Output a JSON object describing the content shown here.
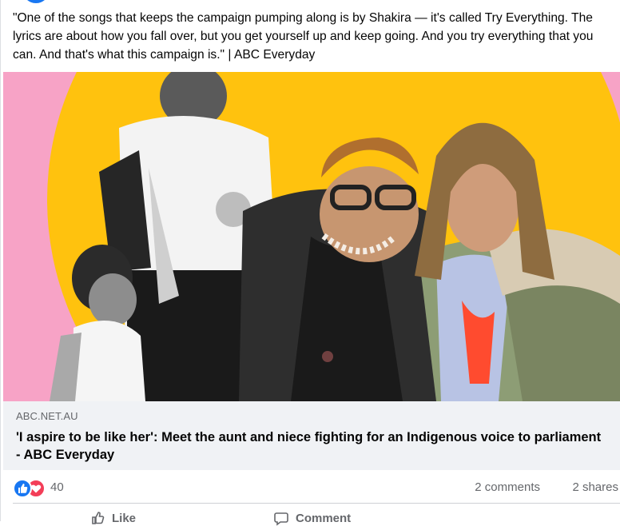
{
  "post": {
    "text": "\"One of the songs that keeps the campaign pumping along is by Shakira — it's called Try Everything. The lyrics are about how you fall over, but you get yourself up and keep going. And you try everything that you can. And that's what this campaign is.\" | ABC Everyday"
  },
  "link": {
    "domain": "ABC.NET.AU",
    "headline": "'I aspire to be like her': Meet the aunt and niece fighting for an Indigenous voice to parliament - ABC Everyday"
  },
  "stats": {
    "reactions_count": "40",
    "comments": "2 comments",
    "shares": "2 shares"
  },
  "actions": {
    "like": "Like",
    "comment": "Comment"
  },
  "colors": {
    "link_bg": "#f0f2f5",
    "image_pink": "#f7a3c6",
    "image_yellow": "#ffc20e",
    "like_blue": "#1877f2",
    "love_red": "#f33e58"
  }
}
